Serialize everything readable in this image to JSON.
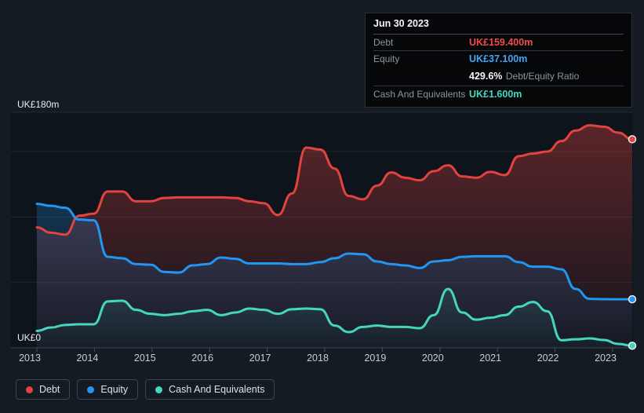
{
  "tooltip": {
    "title": "Jun 30 2023",
    "debt": {
      "label": "Debt",
      "value": "UK£159.400m"
    },
    "equity": {
      "label": "Equity",
      "value": "UK£37.100m"
    },
    "ratio": {
      "value": "429.6%",
      "label": "Debt/Equity Ratio"
    },
    "cash": {
      "label": "Cash And Equivalents",
      "value": "UK£1.600m"
    }
  },
  "axis": {
    "y_top_label": "UK£180m",
    "y_zero_label": "UK£0",
    "x_tick_labels": [
      "2013",
      "2014",
      "2015",
      "2016",
      "2017",
      "2018",
      "2019",
      "2020",
      "2021",
      "2022",
      "2023"
    ],
    "gridline_values": [
      50,
      100,
      150,
      180
    ],
    "ylim": [
      0,
      180
    ]
  },
  "legend": {
    "items": [
      {
        "label": "Debt",
        "color": "#e2433f"
      },
      {
        "label": "Equity",
        "color": "#2196f3"
      },
      {
        "label": "Cash And Equivalents",
        "color": "#45d6bf"
      }
    ]
  },
  "colors": {
    "page_bg": "#151b23",
    "plot_bg": "#0e141c",
    "grid_line": "rgba(255,255,255,0.08)",
    "axis_line": "#39424c",
    "tick_mark": "#4a525b",
    "marker_ring": "#e9edf0",
    "debt": "#e2433f",
    "equity": "#2196f3",
    "cash": "#45d6bf",
    "tooltip_debt_value": "#ef4b4b",
    "tooltip_equity_value": "#42a5f5",
    "tooltip_cash_value": "#45d6bf"
  },
  "chart_data": {
    "type": "area",
    "unit": "UK£ millions",
    "x_unit": "year (quarterly points)",
    "x": [
      2013.0,
      2013.25,
      2013.5,
      2013.75,
      2014.0,
      2014.25,
      2014.5,
      2014.75,
      2015.0,
      2015.25,
      2015.5,
      2015.75,
      2016.0,
      2016.25,
      2016.5,
      2016.75,
      2017.0,
      2017.25,
      2017.5,
      2017.75,
      2018.0,
      2018.25,
      2018.5,
      2018.75,
      2019.0,
      2019.25,
      2019.5,
      2019.75,
      2020.0,
      2020.25,
      2020.5,
      2020.75,
      2021.0,
      2021.25,
      2021.5,
      2021.75,
      2022.0,
      2022.25,
      2022.5,
      2022.75,
      2023.0,
      2023.25,
      2023.5
    ],
    "ylim": [
      0,
      180
    ],
    "grid": true,
    "legend_position": "bottom",
    "series": [
      {
        "name": "Debt",
        "color": "#e2433f",
        "values": [
          92,
          88,
          86.5,
          101,
          102.5,
          119.5,
          119.5,
          112,
          112,
          114.5,
          115,
          115,
          115,
          115,
          114.5,
          112,
          110.5,
          101.5,
          118,
          153,
          151.5,
          137,
          116,
          113.5,
          124,
          134,
          130,
          128,
          135,
          139.5,
          131,
          130,
          134.5,
          132,
          146.5,
          148.5,
          150,
          158,
          166,
          170,
          169,
          164.5,
          159.4
        ]
      },
      {
        "name": "Equity",
        "color": "#2196f3",
        "values": [
          110,
          108.5,
          107,
          98,
          97.5,
          69.5,
          68.5,
          64,
          63.5,
          58,
          57.5,
          63,
          64,
          69,
          68,
          64.5,
          64.5,
          64.5,
          64,
          64,
          65.5,
          68.5,
          72,
          71.5,
          66,
          64,
          63,
          61,
          66,
          67,
          69.5,
          70,
          70,
          70,
          65.5,
          62,
          62,
          60,
          45,
          37.4,
          37.2,
          37.1,
          37.1
        ]
      },
      {
        "name": "Cash And Equivalents",
        "color": "#45d6bf",
        "values": [
          13,
          15.5,
          17.5,
          18,
          18,
          35.5,
          36,
          29,
          26,
          25,
          26,
          28,
          29,
          25,
          27,
          30,
          29,
          26,
          29.5,
          30,
          29.5,
          17,
          12,
          16,
          17,
          16,
          16,
          15,
          25,
          45,
          27,
          21.5,
          23,
          25,
          31.5,
          35,
          28,
          5.8,
          6.5,
          7.2,
          6,
          3,
          1.6
        ]
      }
    ]
  }
}
